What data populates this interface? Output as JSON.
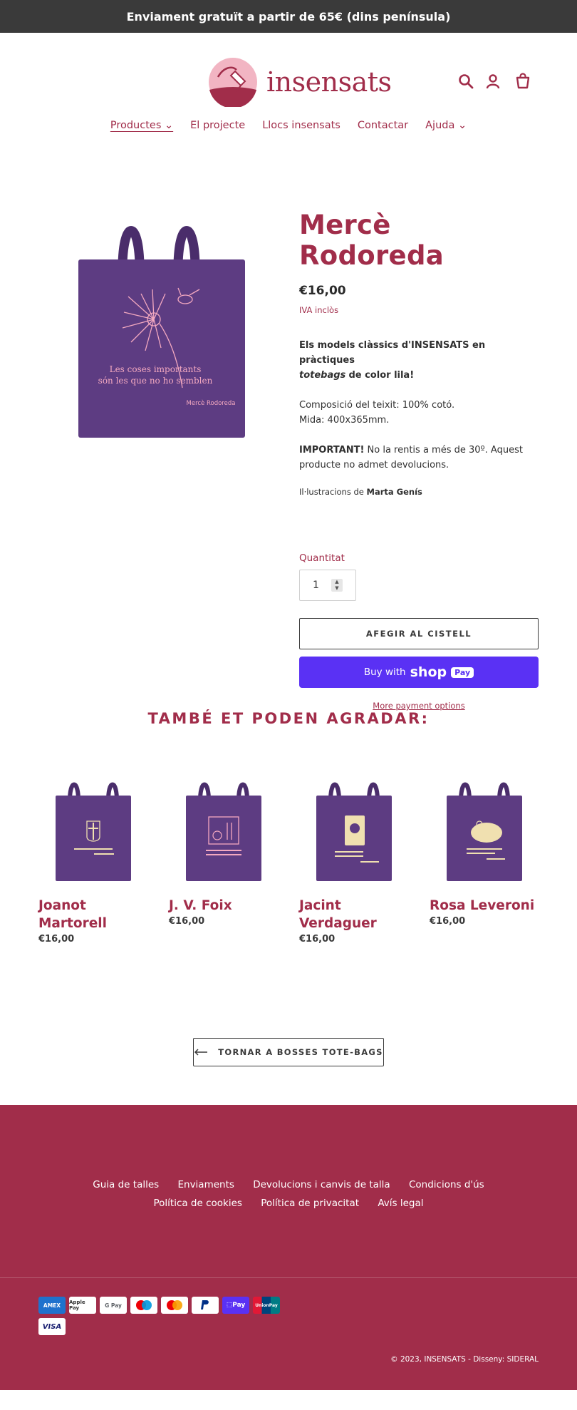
{
  "announcement": "Enviament gratuït a partir de 65€ (dins península)",
  "brand": {
    "name": "insensats"
  },
  "nav": [
    {
      "label": "Productes ⌄",
      "active": true
    },
    {
      "label": "El projecte"
    },
    {
      "label": "Llocs insensats"
    },
    {
      "label": "Contactar"
    },
    {
      "label": "Ajuda ⌄"
    }
  ],
  "product": {
    "title": "Mercè Rodoreda",
    "price": "€16,00",
    "tax_note": "IVA inclòs",
    "desc_bold_1": "Els models clàssics d'INSENSATS en pràctiques",
    "desc_italic": "totebags",
    "desc_bold_2": "de color lila!",
    "composition": "Composició del teixit: 100% cotó.",
    "size": "Mida: 400x365mm.",
    "important_label": "IMPORTANT!",
    "important_text": "No la rentis a més de 30º. Aquest producte no admet devolucions.",
    "illus_prefix": "Il·lustracions de",
    "illus_author": "Marta Genís",
    "quantity_label": "Quantitat",
    "quantity_value": "1",
    "add_to_cart": "AFEGIR AL CISTELL",
    "buy_with": "Buy with",
    "shop_word": "shop",
    "pay_word": "Pay",
    "more_payment": "More payment options",
    "bag_quote_1": "Les coses importants",
    "bag_quote_2": "són les que no ho semblen",
    "bag_signature": "Mercè Rodoreda"
  },
  "related": {
    "heading": "TAMBÉ ET PODEN AGRADAR:",
    "items": [
      {
        "name": "Joanot Martorell",
        "price": "€16,00"
      },
      {
        "name": "J. V. Foix",
        "price": "€16,00"
      },
      {
        "name": "Jacint Verdaguer",
        "price": "€16,00"
      },
      {
        "name": "Rosa Leveroni",
        "price": "€16,00"
      }
    ]
  },
  "back_button": "TORNAR A BOSSES TOTE-BAGS",
  "footer": {
    "links_row1": [
      "Guia de talles",
      "Enviaments",
      "Devolucions i canvis de talla",
      "Condicions d'ús"
    ],
    "links_row2": [
      "Política de cookies",
      "Política de privacitat",
      "Avís legal"
    ],
    "payments": [
      "AMEX",
      "Apple Pay",
      "G Pay",
      "Maestro",
      "Mastercard",
      "PayPal",
      "Shop Pay",
      "UnionPay",
      "VISA"
    ],
    "copyright": "© 2023, INSENSATS - Disseny: SIDERAL"
  },
  "colors": {
    "accent": "#a12d4a",
    "bag": "#5d3c82",
    "shop_pay": "#5a31f4",
    "topbar": "#3a3a3a"
  }
}
